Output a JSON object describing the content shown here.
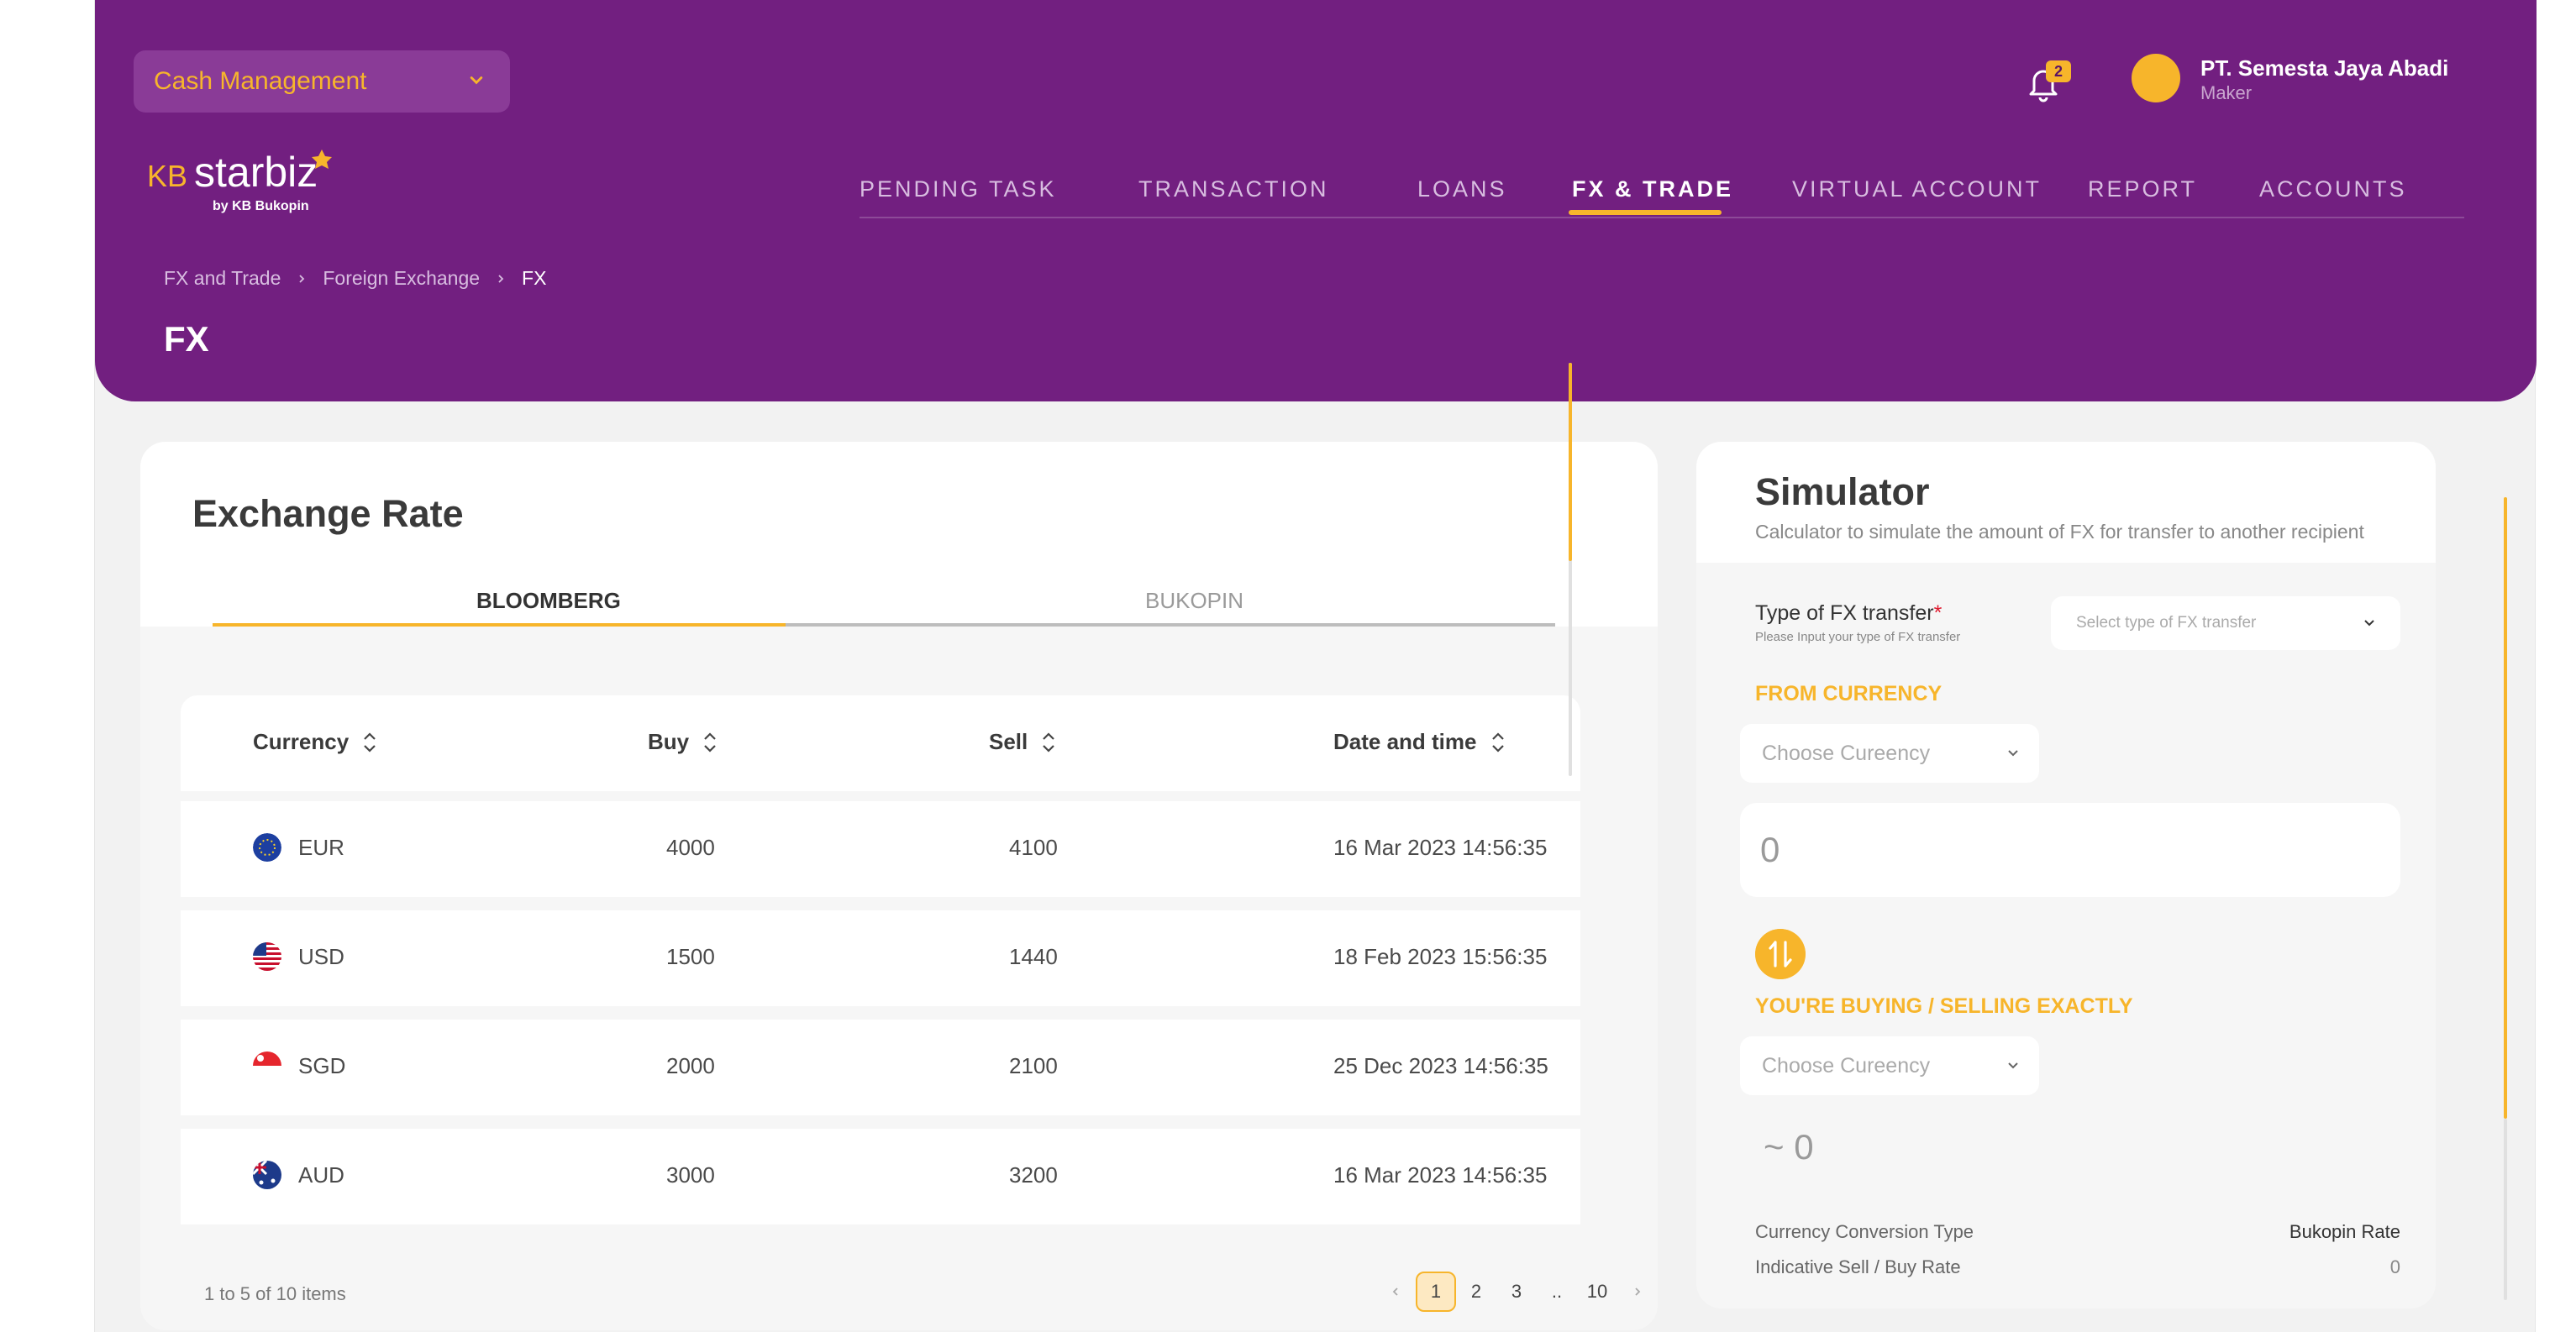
{
  "header": {
    "module": "Cash Management",
    "logo": {
      "kb": "KB",
      "star": "starbiz",
      "by": "by KB Bukopin"
    },
    "notifications": "2",
    "user": {
      "name": "PT. Semesta Jaya Abadi",
      "role": "Maker"
    },
    "nav": [
      "PENDING TASK",
      "TRANSACTION",
      "LOANS",
      "FX & TRADE",
      "VIRTUAL ACCOUNT",
      "REPORT",
      "ACCOUNTS"
    ],
    "active_nav": "FX & TRADE",
    "breadcrumb": [
      "FX and Trade",
      "Foreign Exchange",
      "FX"
    ],
    "title": "FX"
  },
  "exchange": {
    "title": "Exchange Rate",
    "tabs": [
      "BLOOMBERG",
      "BUKOPIN"
    ],
    "active_tab": "BLOOMBERG",
    "columns": [
      "Currency",
      "Buy",
      "Sell",
      "Date and time"
    ],
    "rows": [
      {
        "flag": "eu-flag-icon",
        "currency": "EUR",
        "buy": "4000",
        "sell": "4100",
        "date": "16 Mar 2023 14:56:35"
      },
      {
        "flag": "us-flag-icon",
        "currency": "USD",
        "buy": "1500",
        "sell": "1440",
        "date": "18 Feb 2023 15:56:35"
      },
      {
        "flag": "sg-flag-icon",
        "currency": "SGD",
        "buy": "2000",
        "sell": "2100",
        "date": "25 Dec 2023 14:56:35"
      },
      {
        "flag": "au-flag-icon",
        "currency": "AUD",
        "buy": "3000",
        "sell": "3200",
        "date": "16 Mar 2023 14:56:35"
      }
    ],
    "items_text": "1 to 5 of 10 items",
    "pages": [
      "1",
      "2",
      "3",
      "..",
      "10"
    ],
    "current_page": "1"
  },
  "simulator": {
    "title": "Simulator",
    "subtitle": "Calculator to simulate the amount of FX for transfer to another recipient",
    "type_label": "Type of FX transfer",
    "required_mark": "*",
    "type_hint": "Please Input your type of FX transfer",
    "type_placeholder": "Select type of FX transfer",
    "from_label": "FROM CURRENCY",
    "from_placeholder": "Choose Cureency",
    "from_amount": "0",
    "to_label": "YOU'RE BUYING / SELLING EXACTLY",
    "to_placeholder": "Choose Cureency",
    "to_amount": "~ 0",
    "conversion_label": "Currency Conversion Type",
    "conversion_value": "Bukopin Rate",
    "rate_label": "Indicative Sell / Buy Rate",
    "rate_value": "0"
  },
  "colors": {
    "primary": "#721f80",
    "accent": "#f7b52b",
    "background": "#f2f2f2"
  }
}
